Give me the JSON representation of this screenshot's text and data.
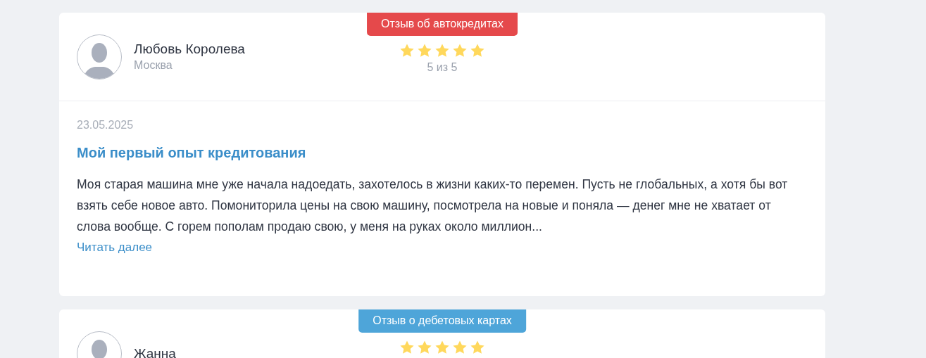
{
  "reviews": [
    {
      "category": "Отзыв об автокредитах",
      "color": "#e5494b",
      "author": "Любовь Королева",
      "city": "Москва",
      "stars": 5,
      "rating": "5 из 5",
      "date": "23.05.2025",
      "title": "Мой первый опыт кредитования",
      "text": "Моя старая машина мне уже начала надоедать, захотелось в жизни каких-то перемен. Пусть не глобальных, а хотя бы вот взять себе новое авто. Помониторила цены на свою машину, посмотрела на новые и поняла — денег мне не хватает от слова вообще. С горем пополам продаю свою, у меня на руках около миллион...",
      "more": "Читать далее"
    },
    {
      "category": "Отзыв о дебетовых картах",
      "color": "#4ea5d9",
      "author": "Жанна",
      "stars": 5
    }
  ]
}
